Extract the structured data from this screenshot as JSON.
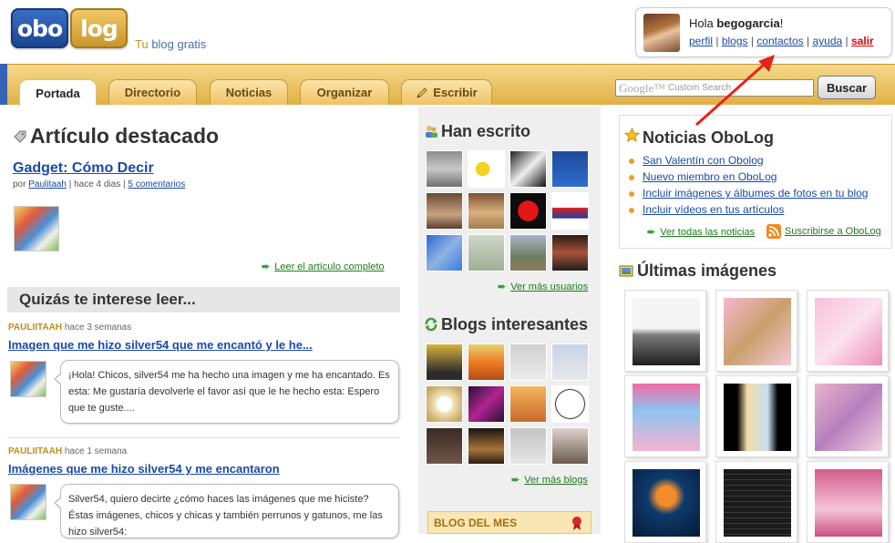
{
  "brand": {
    "logo_left": "obo",
    "logo_right": "log",
    "tagline_prefix": "Tu",
    "tagline_rest": " blog gratis"
  },
  "user": {
    "greeting": "Hola ",
    "username": "begogarcia",
    "greeting_suffix": "!",
    "links": [
      "perfil",
      "blogs",
      "contactos",
      "ayuda",
      "salir"
    ],
    "separator": " | "
  },
  "nav": {
    "tabs": [
      "Portada",
      "Directorio",
      "Noticias",
      "Organizar",
      "Escribir"
    ],
    "active_tab": "Portada"
  },
  "search": {
    "google_mark": "Google™",
    "placeholder": "Custom Search",
    "button_label": "Buscar"
  },
  "featured": {
    "heading": "Artículo destacado",
    "title": "Gadget: Cómo Decir",
    "meta_prefix": "por ",
    "author": "Paulitaah",
    "meta_time": " | hace 4 dias | ",
    "comments": "5 comentarios",
    "read_more": "Leer el artículo completo"
  },
  "suggested": {
    "heading": "Quizás te interese leer...",
    "posts": [
      {
        "author": "PAULIITAAH",
        "time": " hace 3 semanas",
        "title": "Imagen que me hizo silver54 que me encantó y le he...",
        "excerpt": "¡Hola! Chicos, silver54 me ha hecho una imagen y me ha encantado. Es esta:  Me gustaría devolverle el favor así que le he hecho esta: Espero que te guste...."
      },
      {
        "author": "PAULIITAAH",
        "time": " hace 1 semana",
        "title": "Imágenes que me hizo silver54 y me encantaron",
        "excerpt": "  Silver54, quiero decirte ¿cómo haces las imágenes que me hiciste? Éstas imágenes, chicos y chicas y también perrunos y gatunos, me las hizo silver54:"
      }
    ]
  },
  "middle": {
    "han_escrito": "Han escrito",
    "ver_usuarios": "Ver más usuarios",
    "blogs_interesantes": "Blogs interesantes",
    "ver_blogs": "Ver más blogs",
    "blog_del_mes": "BLOG DEL MES"
  },
  "news": {
    "heading": "Noticias OboLog",
    "items": [
      "San Valentín con Obolog",
      "Nuevo miembro en OboLog",
      "Incluir imágenes y álbumes de fotos en tu blog",
      "Incluir vídeos en tus artículos"
    ],
    "ver_todas": "Ver todas las noticias",
    "suscribirse": "Suscribirse a OboLog"
  },
  "images": {
    "heading": "Últimas imágenes"
  },
  "colors": {
    "nav_gold": "#e1b046",
    "link_blue": "#1a4aa6",
    "link_green": "#1f7a1f",
    "salir_red": "#e00000",
    "arrow_red": "#e8221b"
  }
}
